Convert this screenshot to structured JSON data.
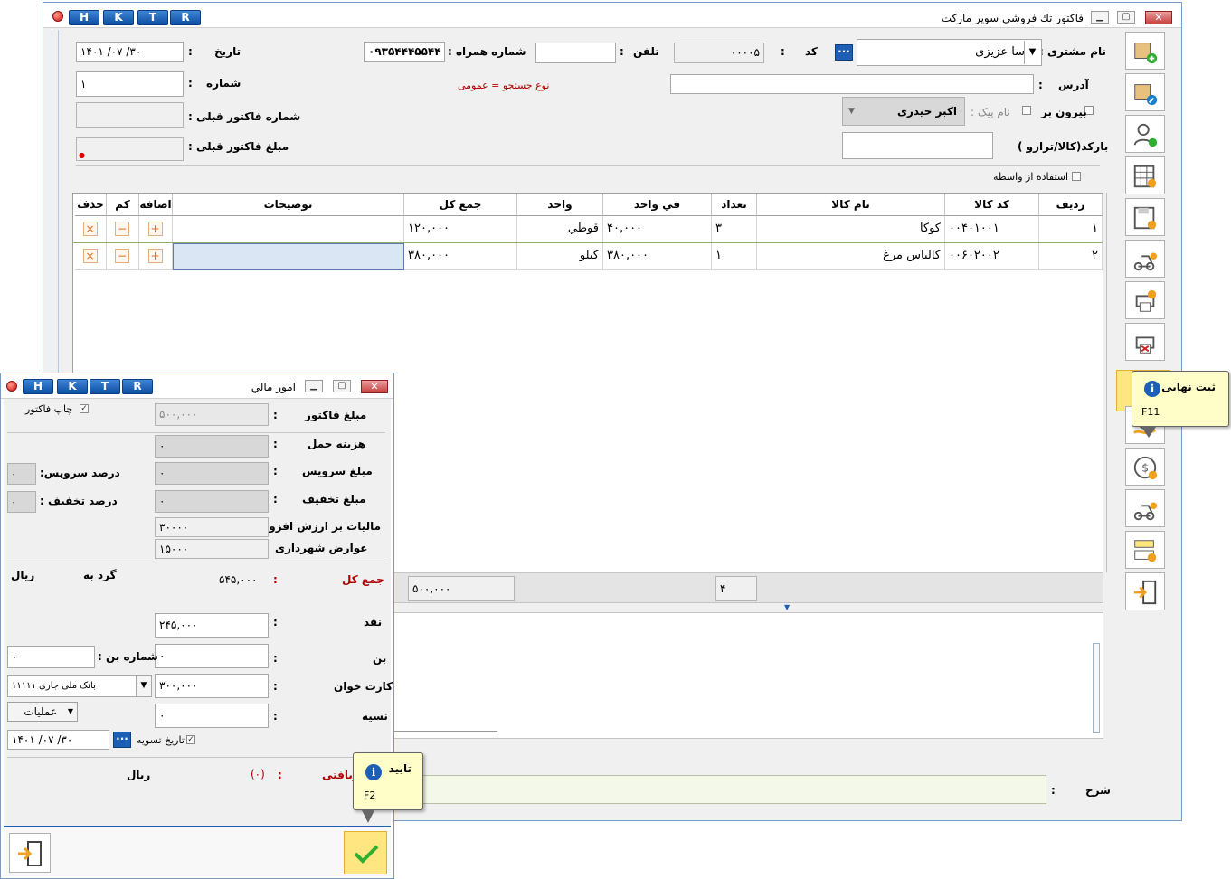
{
  "main_window": {
    "title": "فاکتور تك فروشي سوپر ماركت",
    "hktr": [
      "H",
      "K",
      "T",
      "R"
    ],
    "minimize_icon": "minimize-icon",
    "restore_icon": "restore-icon",
    "close_icon": "close-icon"
  },
  "header": {
    "customer_label": "نام مشتری :",
    "customer_value": "آتوسا عزیزی",
    "code_label": "کد",
    "code_colon": ":",
    "code_value": "۰۰۰۰۵",
    "phone_label": "تلفن",
    "phone_colon": ":",
    "phone_value": "",
    "mobile_label": "شماره همراه :",
    "mobile_value": "۰۹۳۵۴۴۴۵۵۴۴",
    "date_label": "تاریخ",
    "date_colon": ":",
    "date_value": "۱۴۰۱   /۰۷   /۳۰",
    "address_label": "آدرس",
    "address_colon": ":",
    "address_value": "",
    "search_type_note": "نوع جستجو = عمومی",
    "number_label": "شماره",
    "number_colon": ":",
    "number_value": "۱",
    "takeaway_label": "بیرون بر",
    "courier_label": "نام پیک :",
    "courier_value": "اکبر حیدری",
    "prev_invoice_no_label": "شماره فاکتور قبلی :",
    "prev_invoice_amount_label": "مبلغ فاکتور قبلی :",
    "barcode_label": "بارکد(کالا/ترازو )",
    "intermediary_label": "استفاده از واسطه"
  },
  "grid": {
    "columns": [
      "ردیف",
      "کد کالا",
      "نام کالا",
      "تعداد",
      "في واحد",
      "واحد",
      "جمع کل",
      "توضیحات",
      "اضافه",
      "کم",
      "حذف"
    ],
    "rows": [
      {
        "row": "۱",
        "code": "۰۰۴۰۱۰۰۱",
        "name": "کوکا",
        "qty": "۳",
        "unit_price": "۴۰,۰۰۰",
        "unit": "قوطي",
        "total": "۱۲۰,۰۰۰",
        "desc": ""
      },
      {
        "row": "۲",
        "code": "۰۰۶۰۲۰۰۲",
        "name": "کالباس مرغ",
        "qty": "۱",
        "unit_price": "۳۸۰,۰۰۰",
        "unit": "کیلو",
        "total": "۳۸۰,۰۰۰",
        "desc": ""
      }
    ],
    "add_symbol": "+",
    "minus_symbol": "−",
    "delete_symbol": "×"
  },
  "footer": {
    "sum_total": "۵۰۰,۰۰۰",
    "count_total": "۴",
    "description_label": "شرح",
    "description_colon": ":",
    "description_value": ""
  },
  "toolbar": {
    "items": [
      "box-add-icon",
      "box-edit-icon",
      "user-add-icon",
      "price-table-icon",
      "save-view-icon",
      "courier-view-icon",
      "print-money-icon",
      "print-cancel-icon",
      "final-register-icon",
      "money-hand-icon",
      "money-cycle-icon",
      "courier-money-icon",
      "scale-icon",
      "exit-icon"
    ]
  },
  "tooltip_final": {
    "title": "ثبت نهایی",
    "key": "F11"
  },
  "finance_window": {
    "title": "امور مالي",
    "print_invoice_label": "چاپ فاکتور",
    "invoice_amount_label": "مبلغ فاکتور",
    "invoice_amount": "۵۰۰,۰۰۰",
    "shipping_label": "هزینه حمل",
    "shipping_value": "۰",
    "service_label": "مبلغ سرویس",
    "service_value": "۰",
    "service_pct_label": "درصد سرویس:",
    "service_pct": "۰",
    "discount_label": "مبلغ تخفیف",
    "discount_value": "۰",
    "discount_pct_label": "درصد تخفیف :",
    "discount_pct": "۰",
    "vat_label": "مالیات بر ارزش افزوده",
    "vat_value": "۳۰۰۰۰",
    "municipal_label": "عوارض شهرداری",
    "municipal_value": "۱۵۰۰۰",
    "grand_total_label": "جمع کل",
    "grand_total": "۵۴۵,۰۰۰",
    "round_label": "گرد به",
    "rial": "ریال",
    "cash_label": "نقد",
    "cash_value": "۲۴۵,۰۰۰",
    "voucher_label": "بن",
    "voucher_value": "۰",
    "voucher_no_label": "شماره بن :",
    "voucher_no": "۰",
    "card_label": "کارت خوان",
    "card_value": "۳۰۰,۰۰۰",
    "bank_value": "بانک ملی جاری ۱۱۱۱۱",
    "credit_label": "نسیه",
    "credit_value": "۰",
    "operations_label": "عملیات",
    "settle_date_label": "تاریخ تسویه",
    "settle_date": "۱۴۰۱   /۰۷   /۳۰",
    "received_label": "ریافتی",
    "received_value": "(۰)",
    "colon": ":"
  },
  "tooltip_confirm": {
    "title": "تایید",
    "key": "F2"
  },
  "colors": {
    "accent": "#1c5fb5",
    "highlight": "#ffe680",
    "status_red": "#b00000",
    "bank_green": "#2fae2f"
  }
}
